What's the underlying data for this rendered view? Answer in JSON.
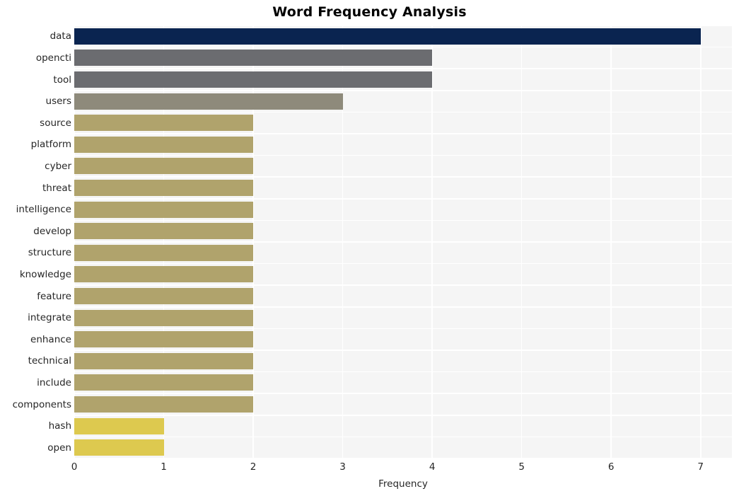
{
  "chart_data": {
    "type": "bar",
    "orientation": "horizontal",
    "title": "Word Frequency Analysis",
    "xlabel": "Frequency",
    "ylabel": "",
    "categories": [
      "data",
      "opencti",
      "tool",
      "users",
      "source",
      "platform",
      "cyber",
      "threat",
      "intelligence",
      "develop",
      "structure",
      "knowledge",
      "feature",
      "integrate",
      "enhance",
      "technical",
      "include",
      "components",
      "hash",
      "open"
    ],
    "values": [
      7,
      4,
      4,
      3,
      2,
      2,
      2,
      2,
      2,
      2,
      2,
      2,
      2,
      2,
      2,
      2,
      2,
      2,
      1,
      1
    ],
    "bar_colors": [
      "#0a2450",
      "#6b6c70",
      "#6b6c70",
      "#8e8a7b",
      "#b0a36c",
      "#b0a36c",
      "#b0a36c",
      "#b0a36c",
      "#b0a36c",
      "#b0a36c",
      "#b0a36c",
      "#b0a36c",
      "#b0a36c",
      "#b0a36c",
      "#b0a36c",
      "#b0a36c",
      "#b0a36c",
      "#b0a36c",
      "#ddc94f",
      "#ddc94f"
    ],
    "xlim": [
      0,
      7.35
    ],
    "xticks": [
      0,
      1,
      2,
      3,
      4,
      5,
      6,
      7
    ],
    "xtick_labels": [
      "0",
      "1",
      "2",
      "3",
      "4",
      "5",
      "6",
      "7"
    ],
    "grid": true,
    "grid_color": "#ffffff",
    "plot_background": "#f5f5f5",
    "figure_background": "#ffffff",
    "legend": null
  }
}
